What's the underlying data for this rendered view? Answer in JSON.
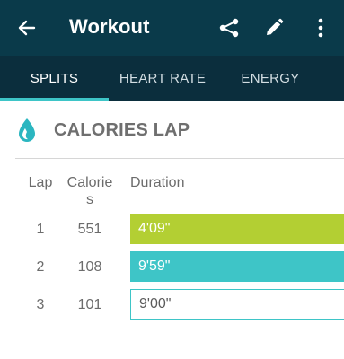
{
  "appbar": {
    "title": "Workout",
    "back_icon": "arrow-left-icon",
    "share_icon": "share-icon",
    "edit_icon": "pencil-icon",
    "menu_icon": "more-vert-icon"
  },
  "tabs": [
    {
      "label": "SPLITS",
      "active": true
    },
    {
      "label": "HEART RATE",
      "active": false
    },
    {
      "label": "ENERGY",
      "active": false
    }
  ],
  "section": {
    "icon": "flame-drop-icon",
    "title": "CALORIES LAP"
  },
  "table": {
    "headers": {
      "lap": "Lap",
      "calories_line1": "Calorie",
      "calories_line2": "s",
      "duration": "Duration"
    },
    "rows": [
      {
        "lap": "1",
        "calories": "551",
        "duration": "4'09\""
      },
      {
        "lap": "2",
        "calories": "108",
        "duration": "9'59\""
      },
      {
        "lap": "3",
        "calories": "101",
        "duration": "9'00\""
      }
    ]
  },
  "colors": {
    "appbar": "#0a3a4a",
    "tabbar": "#0b2e3d",
    "accent": "#3ec5c7",
    "lap1_bar": "#b3cf33",
    "lap2_bar": "#3ec5c7"
  }
}
